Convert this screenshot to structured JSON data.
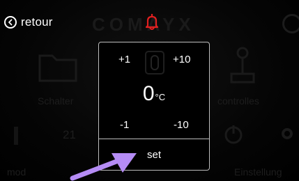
{
  "header": {
    "back_label": "retour",
    "brand": "COMAYX"
  },
  "background": {
    "tile_left_label": "Schalter",
    "tile_right_label": "controlles",
    "readout_left": "21",
    "bottom_left_label": "mod",
    "bottom_right_label": "Einstellung"
  },
  "modal": {
    "plus_one": "+1",
    "plus_ten": "+10",
    "minus_one": "-1",
    "minus_ten": "-10",
    "value": "0",
    "unit": "°C",
    "set_label": "set"
  },
  "colors": {
    "brand_bell": "#e02020",
    "arrow": "#b58cf5",
    "modal_border": "#bdbdbd"
  },
  "icons": {
    "back": "circle-chevron-left-icon",
    "bell": "bell-icon",
    "thermostat": "thermostat-icon",
    "arrow": "arrow-pointer-icon"
  }
}
